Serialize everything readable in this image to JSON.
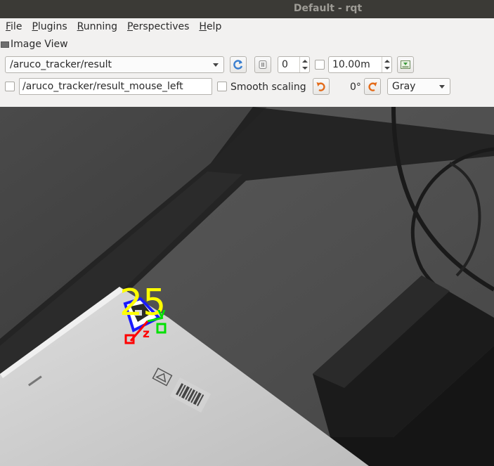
{
  "window": {
    "title": "Default - rqt"
  },
  "menu": [
    {
      "label": "File",
      "mnemonic": "F",
      "rest": "ile"
    },
    {
      "label": "Plugins",
      "mnemonic": "P",
      "rest": "lugins"
    },
    {
      "label": "Running",
      "mnemonic": "R",
      "rest": "unning"
    },
    {
      "label": "Perspectives",
      "mnemonic": "P",
      "rest": "erspectives"
    },
    {
      "label": "Help",
      "mnemonic": "H",
      "rest": "elp"
    }
  ],
  "dock": {
    "title": "Image View"
  },
  "toolbar": {
    "topic": "/aruco_tracker/result",
    "frame_value": "0",
    "max_range": "10.00m",
    "mouse_topic": "/aruco_tracker/result_mouse_left",
    "smooth_scaling_label": "Smooth scaling",
    "rotation": "0°",
    "color_scheme": "Gray"
  },
  "image": {
    "marker_id": "25",
    "axis_y": "y",
    "axis_z": "z"
  },
  "colors": {
    "marker_border": "#1a1aff",
    "marker_id": "#ffff00",
    "axis_x": "#ff0000",
    "axis_y": "#00e000",
    "axis_z": "#ff0000",
    "refresh_icon": "#3a7fd0",
    "rotate_icon": "#e36b1a"
  }
}
